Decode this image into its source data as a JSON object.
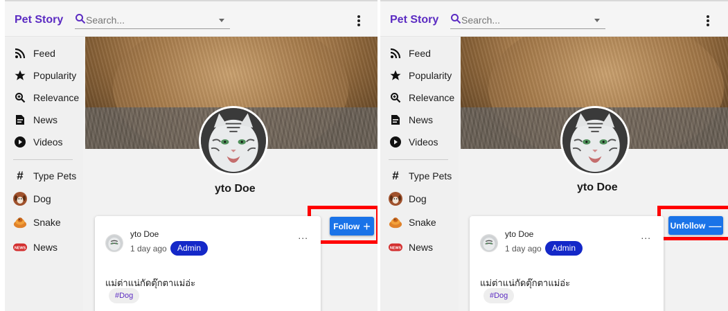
{
  "app": {
    "brand": "Pet Story"
  },
  "search": {
    "placeholder": "Search..."
  },
  "sidebar": {
    "items": [
      {
        "label": "Feed",
        "icon": "rss-icon"
      },
      {
        "label": "Popularity",
        "icon": "star-icon"
      },
      {
        "label": "Relevance",
        "icon": "zoom-in-icon"
      },
      {
        "label": "News",
        "icon": "article-icon"
      },
      {
        "label": "Videos",
        "icon": "play-circle-icon"
      }
    ],
    "types_header": {
      "label": "Type Pets",
      "icon": "hashtag-icon"
    },
    "types": [
      {
        "label": "Dog",
        "icon": "dog-icon"
      },
      {
        "label": "Snake",
        "icon": "snake-icon"
      },
      {
        "label": "News",
        "icon": "news-badge-icon"
      }
    ]
  },
  "profile": {
    "name": "yto Doe"
  },
  "panels": {
    "before": {
      "button_label": "Follow",
      "button_glyph": "+"
    },
    "after": {
      "button_label": "Unfollow",
      "button_glyph": "—"
    }
  },
  "post": {
    "author": "yto Doe",
    "time": "1 day ago",
    "role_badge": "Admin",
    "more": "...",
    "content": "แม่ต่าแน่กัดตุ๊กตาแม่อ่ะ",
    "tag": "#Dog"
  },
  "colors": {
    "brand": "#5b2bc2",
    "button": "#1a73e8",
    "badge": "#1428c8",
    "highlight": "#ff0000"
  }
}
